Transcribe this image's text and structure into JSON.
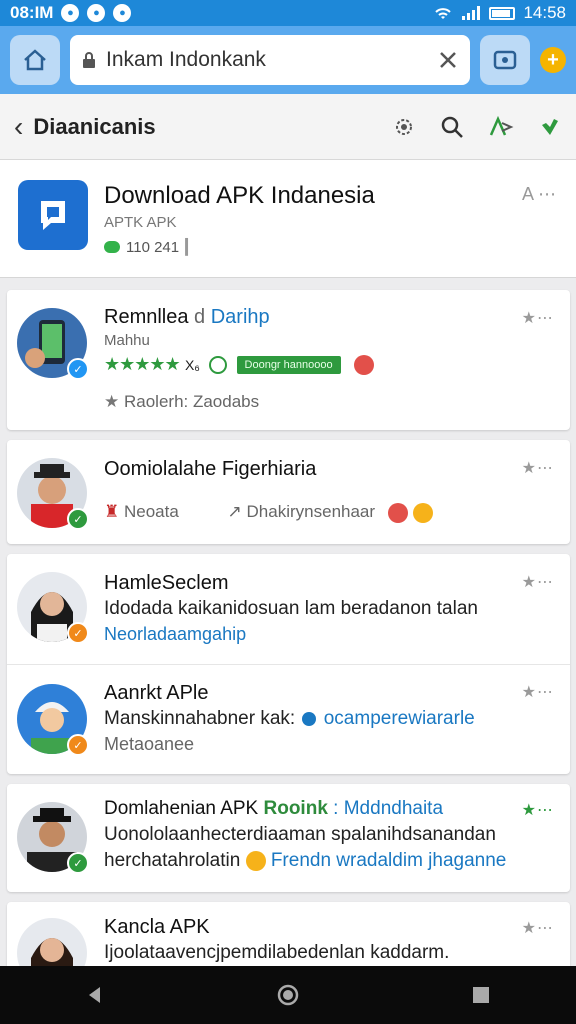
{
  "status_bar": {
    "time": "08:IM",
    "right_time": "14:58"
  },
  "browser": {
    "url": "Inkam Indonkank"
  },
  "toolbar": {
    "title": "Diaanicanis"
  },
  "header": {
    "title": "Download APK Indanesia",
    "subtitle": "APTK APK",
    "count": "110 241",
    "menu": "A ⋯"
  },
  "items": [
    {
      "name": "Remnllea",
      "name_link": "Darihp",
      "sub": "Mahhu",
      "stars": "★★★★★",
      "stars_text": "X₆",
      "badge_text": "Doongr hannoooo",
      "meta": "Raolerh: Zaodabs",
      "menu": "★⋯"
    },
    {
      "name": "Oomiolalahe Figerhiaria",
      "meta_left": "Neoata",
      "meta_right": "Dhakirynsenhaar",
      "menu": "★⋯"
    },
    {
      "name": "HamleSeclem",
      "line1": "Idodada kaikanidosuan lam beradanon talan",
      "line2": "Neorladaamgahip",
      "menu": "★⋯"
    },
    {
      "name": "Aanrkt APle",
      "line1": "Manskinnahabner kak:",
      "line1_link": "ocamperewiararle",
      "line2": "Metaoanee",
      "menu": "★⋯"
    },
    {
      "name": "Domlahenian APK",
      "name_green": "Rooink",
      "name_link": ": Mddndhaita",
      "line1": "Uonololaanhecterdiaaman spalanihdsanandan",
      "line2": "herchatahrolatin",
      "line2_link": "Frendn wradaldim jhaganne",
      "menu": "★⋯"
    },
    {
      "name": "Kancla APK",
      "line1": "Ijoolataavencjpemdilabedenlan kaddarm.",
      "menu": "★⋯"
    }
  ],
  "colors": {
    "status_bar": "#1e88d8",
    "browser_bar": "#5aa9ee",
    "accent_green": "#2e9a3e",
    "link_blue": "#1a78c2"
  }
}
